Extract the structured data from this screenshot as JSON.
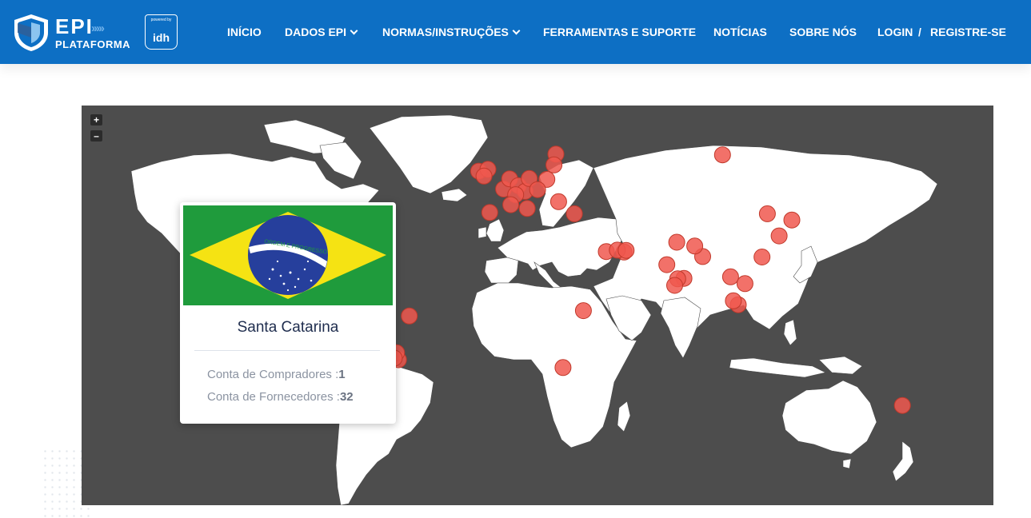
{
  "brand": {
    "name_top": "EPI",
    "name_bottom": "PLATAFORMA",
    "powered_by": "powered by",
    "partner": "idh"
  },
  "nav": {
    "inicio": "INÍCIO",
    "dados": "DADOS EPI",
    "normas": "NORMAS/INSTRUÇÕES",
    "ferramentas": "FERRAMENTAS E SUPORTE",
    "noticias": "NOTÍCIAS",
    "sobre": "SOBRE NÓS",
    "login": "LOGIN",
    "sep": "/",
    "registre": "REGISTRE-SE"
  },
  "map": {
    "zoom_in": "+",
    "zoom_out": "–",
    "colors": {
      "ocean": "#4d4d4d",
      "land": "#ffffff",
      "marker": "#f0584f",
      "marker_stroke": "#c0392b"
    },
    "markers": [
      {
        "lon": -49.3,
        "lat": -26.6,
        "selected": true
      },
      {
        "lon": -48.5,
        "lat": -27.6
      },
      {
        "lon": -49.5,
        "lat": -25.4
      },
      {
        "lon": -46.6,
        "lat": -23.5
      },
      {
        "lon": -43.2,
        "lat": -22.9
      },
      {
        "lon": -44.0,
        "lat": -19.9
      },
      {
        "lon": -47.9,
        "lat": -15.8
      },
      {
        "lon": -51.2,
        "lat": -30.0
      },
      {
        "lon": -51.9,
        "lat": -23.4
      },
      {
        "lon": -38.5,
        "lat": -3.7
      },
      {
        "lon": -45.0,
        "lat": -22.2
      },
      {
        "lon": -8.5,
        "lat": 54.9
      },
      {
        "lon": -4.5,
        "lat": 55.5
      },
      {
        "lon": -6.2,
        "lat": 53.3
      },
      {
        "lon": -3.7,
        "lat": 40.4
      },
      {
        "lon": 2.3,
        "lat": 48.9
      },
      {
        "lon": 4.9,
        "lat": 52.4
      },
      {
        "lon": 8.7,
        "lat": 50.1
      },
      {
        "lon": 12.5,
        "lat": 41.9
      },
      {
        "lon": 11.6,
        "lat": 48.1
      },
      {
        "lon": 13.4,
        "lat": 52.5
      },
      {
        "lon": 21.0,
        "lat": 52.2
      },
      {
        "lon": 24.9,
        "lat": 60.2
      },
      {
        "lon": 24.1,
        "lat": 56.9
      },
      {
        "lon": 17.0,
        "lat": 48.7
      },
      {
        "lon": 7.5,
        "lat": 46.9
      },
      {
        "lon": 5.4,
        "lat": 43.3
      },
      {
        "lon": 26.1,
        "lat": 44.4
      },
      {
        "lon": 32.9,
        "lat": 39.9
      },
      {
        "lon": 46.7,
        "lat": 24.7
      },
      {
        "lon": 54.4,
        "lat": 24.5
      },
      {
        "lon": 51.5,
        "lat": 25.3
      },
      {
        "lon": 55.3,
        "lat": 25.2
      },
      {
        "lon": 36.8,
        "lat": -1.3
      },
      {
        "lon": 28.0,
        "lat": -26.2
      },
      {
        "lon": 72.9,
        "lat": 19.1
      },
      {
        "lon": 77.2,
        "lat": 28.6
      },
      {
        "lon": 80.3,
        "lat": 13.1
      },
      {
        "lon": 77.6,
        "lat": 12.9
      },
      {
        "lon": 76.3,
        "lat": 10.0
      },
      {
        "lon": 88.4,
        "lat": 22.6
      },
      {
        "lon": 85.0,
        "lat": 27.0
      },
      {
        "lon": 97.0,
        "lat": 60.0
      },
      {
        "lon": 116.4,
        "lat": 39.9
      },
      {
        "lon": 127.0,
        "lat": 37.5
      },
      {
        "lon": 121.5,
        "lat": 31.2
      },
      {
        "lon": 114.1,
        "lat": 22.4
      },
      {
        "lon": 100.5,
        "lat": 13.8
      },
      {
        "lon": 106.7,
        "lat": 10.8
      },
      {
        "lon": 103.8,
        "lat": 1.35
      },
      {
        "lon": 101.7,
        "lat": 3.1
      },
      {
        "lon": 174.8,
        "lat": -41.3
      }
    ]
  },
  "popup": {
    "region": "Santa Catarina",
    "buyers_label": "Conta de Compradores :",
    "buyers_count": "1",
    "suppliers_label": "Conta de Fornecedores :",
    "suppliers_count": "32",
    "flag_motto": "ORDEM E PROGRESSO",
    "flag_colors": {
      "green": "#1f9b3c",
      "yellow": "#f5e313",
      "blue": "#263f9c"
    }
  }
}
